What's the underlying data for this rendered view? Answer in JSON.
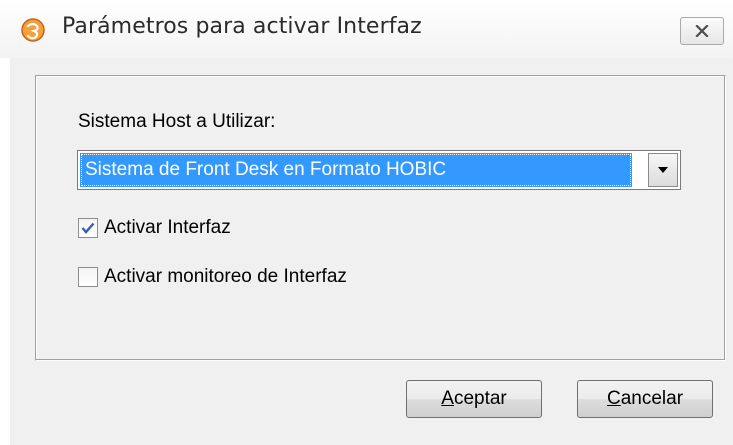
{
  "window": {
    "title": "Parámetros para activar Interfaz",
    "close_icon": "close-icon"
  },
  "form": {
    "host_label": "Sistema Host a Utilizar:",
    "host_select": {
      "selected_value": "Sistema de Front Desk en Formato HOBIC"
    },
    "checkboxes": [
      {
        "label": "Activar Interfaz",
        "checked": true
      },
      {
        "label": "Activar monitoreo de Interfaz",
        "checked": false
      }
    ]
  },
  "buttons": {
    "accept": {
      "mnemonic": "A",
      "rest": "ceptar"
    },
    "cancel": {
      "mnemonic": "C",
      "rest": "ancelar"
    }
  },
  "colors": {
    "selection": "#3399ff",
    "dialog_bg": "#f0f0f0",
    "checkmark": "#3a5fa8"
  }
}
